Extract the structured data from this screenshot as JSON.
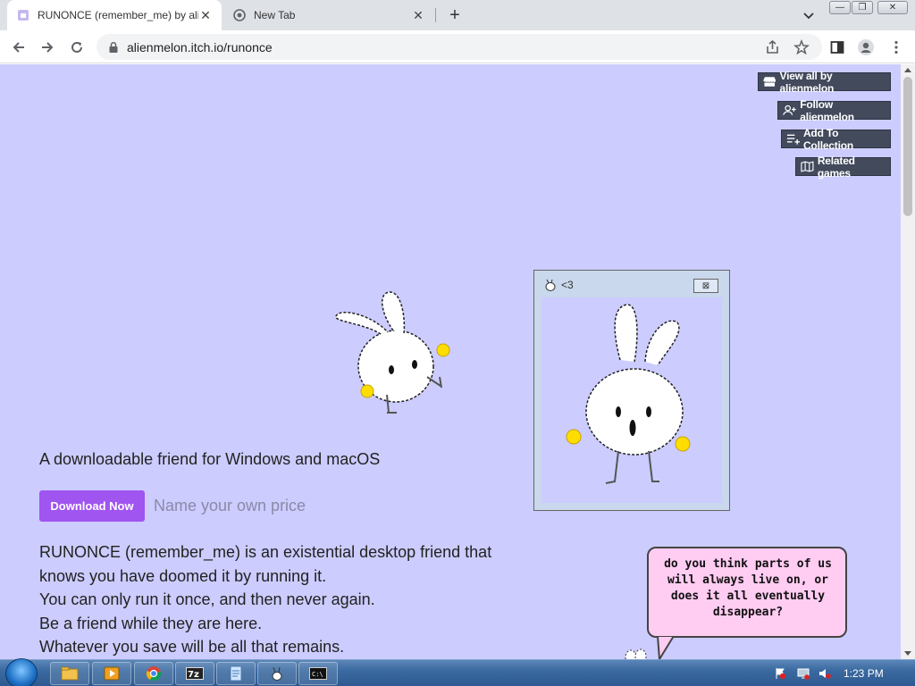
{
  "browser": {
    "tabs": [
      {
        "title": "RUNONCE (remember_me) by alienmelon",
        "active": true
      },
      {
        "title": "New Tab",
        "active": false
      }
    ],
    "url": "alienmelon.itch.io/runonce"
  },
  "itch_buttons": {
    "view_all": "View all by alienmelon",
    "follow": "Follow alienmelon",
    "add_collection": "Add To Collection",
    "related": "Related games"
  },
  "page": {
    "tagline": "A downloadable friend for Windows and macOS",
    "download_label": "Download Now",
    "price_label": "Name your own price",
    "description": [
      "RUNONCE (remember_me) is an existential desktop friend that",
      "knows you have doomed it by running it.",
      "You can only run it once, and then never again.",
      "Be a friend while they are here.",
      "Whatever you save will be all that remains."
    ],
    "popup_title": "<3",
    "bubble_text": "do you think parts of us will always live on, or does it all eventually disappear?"
  },
  "taskbar": {
    "clock": "1:23 PM"
  },
  "colors": {
    "page_bg": "#ccccff",
    "download_btn": "#a054f0",
    "itch_btn": "#424a5c",
    "bubble": "#ffccf2"
  }
}
